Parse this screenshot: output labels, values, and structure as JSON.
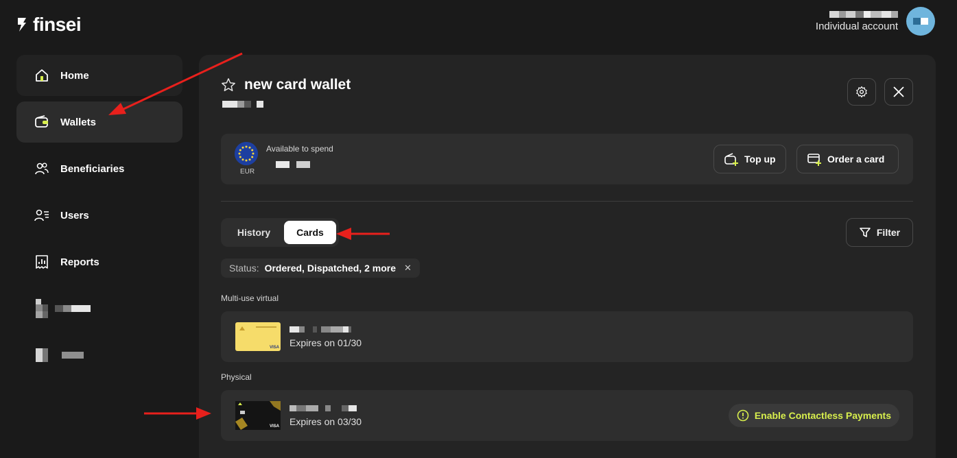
{
  "app": {
    "logo_text": "finsei"
  },
  "account": {
    "type_label": "Individual account"
  },
  "sidebar": {
    "items": [
      {
        "label": "Home",
        "icon": "home-icon"
      },
      {
        "label": "Wallets",
        "icon": "wallet-icon"
      },
      {
        "label": "Beneficiaries",
        "icon": "people-icon"
      },
      {
        "label": "Users",
        "icon": "users-list-icon"
      },
      {
        "label": "Reports",
        "icon": "reports-icon"
      }
    ]
  },
  "wallet": {
    "title": "new card wallet",
    "currency": "EUR",
    "available_label": "Available to spend",
    "top_up_label": "Top up",
    "order_card_label": "Order a card"
  },
  "tabs": {
    "history": "History",
    "cards": "Cards",
    "active": "Cards"
  },
  "filter": {
    "button_label": "Filter",
    "status_label": "Status:",
    "status_value": "Ordered, Dispatched, 2 more",
    "clear_symbol": "✕"
  },
  "cards": {
    "sections": [
      {
        "label": "Multi-use virtual",
        "cards": [
          {
            "expiry": "Expires on 01/30",
            "style": "yellow"
          }
        ]
      },
      {
        "label": "Physical",
        "cards": [
          {
            "expiry": "Expires on 03/30",
            "style": "black",
            "action": "Enable Contactless Payments"
          }
        ]
      }
    ]
  },
  "colors": {
    "accent": "#d8ef4d",
    "arrow": "#e8201c"
  }
}
